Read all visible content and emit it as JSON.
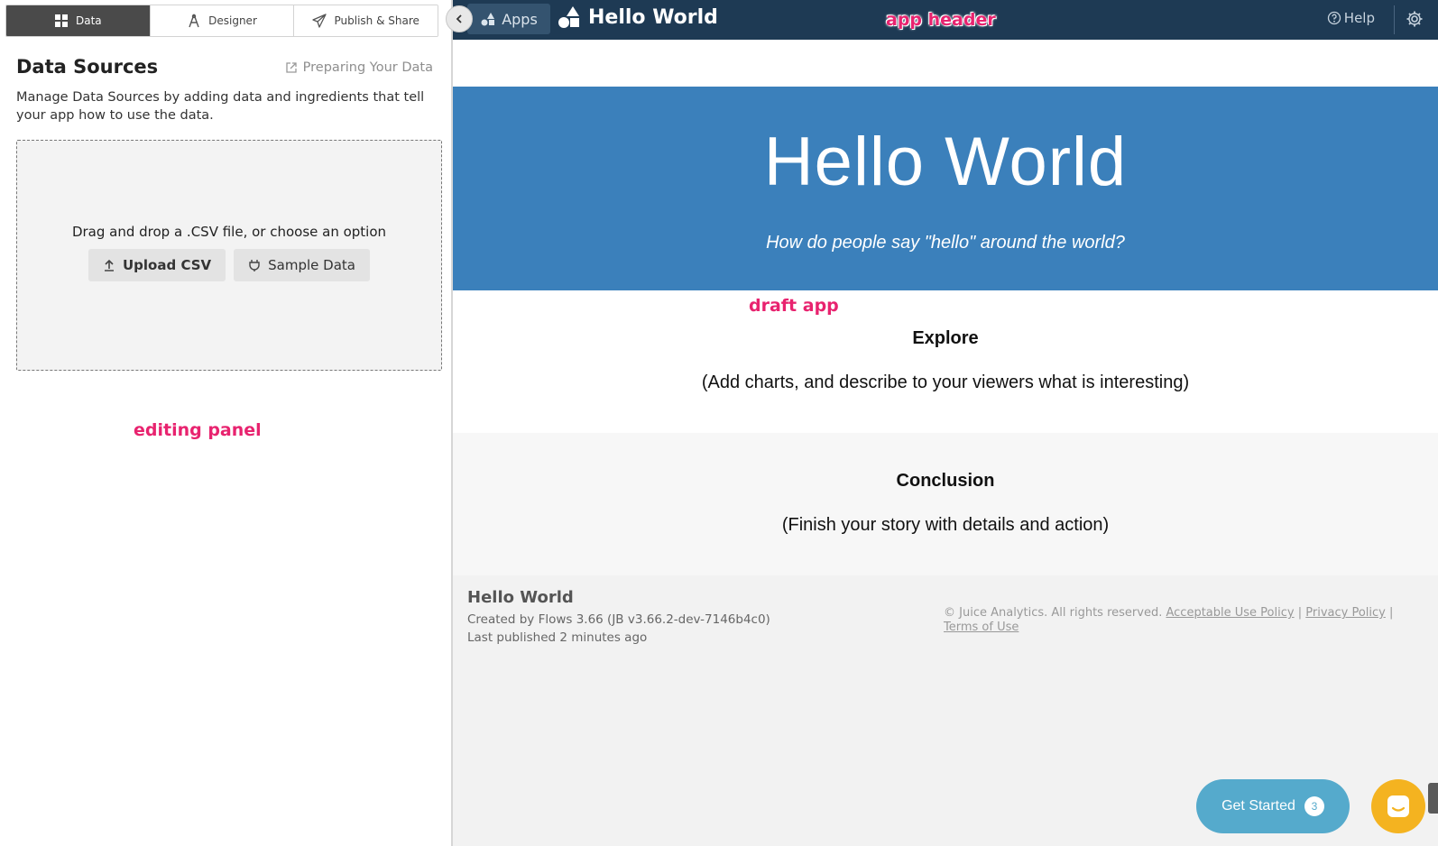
{
  "tabs": [
    {
      "label": "Data",
      "icon": "grid-icon",
      "active": true
    },
    {
      "label": "Designer",
      "icon": "compass-icon",
      "active": false
    },
    {
      "label": "Publish & Share",
      "icon": "paper-plane-icon",
      "active": false
    }
  ],
  "panel": {
    "title": "Data Sources",
    "help_link": "Preparing Your Data",
    "description": "Manage Data Sources by adding data and ingredients that tell your app how to use the data.",
    "dropzone": {
      "text": "Drag and drop a .CSV file, or choose an option",
      "upload_label": "Upload CSV",
      "sample_label": "Sample Data"
    }
  },
  "annotations": {
    "editing_panel": "editing panel",
    "app_header": "app header",
    "draft_app": "draft app"
  },
  "header": {
    "apps_label": "Apps",
    "title": "Hello World",
    "help_label": "Help",
    "background": "#1e3a54"
  },
  "app": {
    "hero_title": "Hello World",
    "hero_subtitle": "How do people say \"hello\" around the world?",
    "hero_color": "#3b80bb",
    "explore_title": "Explore",
    "explore_body": "(Add charts, and describe to your viewers what is interesting)",
    "conclusion_title": "Conclusion",
    "conclusion_body": "(Finish your story with details and action)"
  },
  "footer": {
    "title": "Hello World",
    "created": "Created by Flows 3.66 (JB v3.66.2-dev-7146b4c0)",
    "published": "Last published 2 minutes ago",
    "copyright": "© Juice Analytics. All rights reserved.",
    "acceptable_use": "Acceptable Use Policy",
    "privacy": "Privacy Policy",
    "terms": "Terms of Use",
    "separator": "|"
  },
  "widgets": {
    "get_started_label": "Get Started",
    "get_started_count": "3"
  }
}
